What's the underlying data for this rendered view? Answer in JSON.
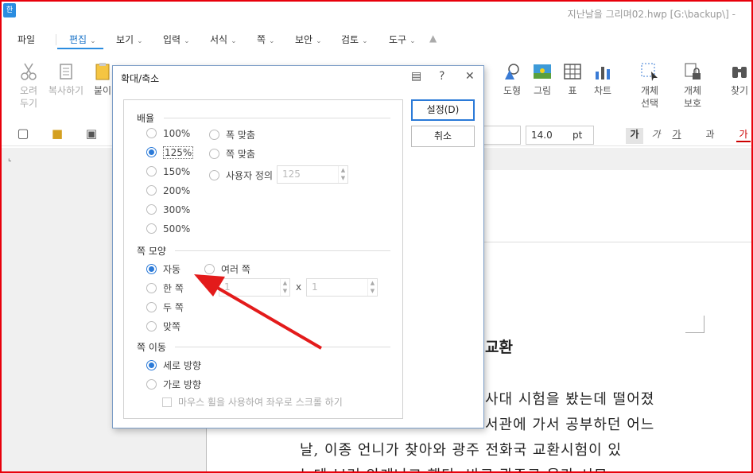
{
  "window": {
    "app_icon": "한",
    "title": "지난날을 그리며02.hwp [G:\\backup\\] - "
  },
  "menu": {
    "items": [
      "파일",
      "편집",
      "보기",
      "입력",
      "서식",
      "쪽",
      "보안",
      "검토",
      "도구"
    ],
    "active": "편집"
  },
  "toolbar": {
    "cut": [
      "오려",
      "두기"
    ],
    "copy": "복사하기",
    "paste": "붙이",
    "shape": "도형",
    "picture": "그림",
    "table": "표",
    "chart": "차트",
    "select_object": [
      "개체",
      "선택"
    ],
    "protect_object": [
      "개체",
      "보호"
    ],
    "find": "찾기"
  },
  "format_bar": {
    "font_size": "14.0",
    "unit": "pt",
    "bold_glyph": "가",
    "italic_glyph": "가",
    "underline_glyph": "가",
    "strike_glyph": "과",
    "color_glyph": "가"
  },
  "dialog": {
    "title": "확대/축소",
    "ok_label": "설정(D)",
    "cancel_label": "취소",
    "zoom": {
      "label": "배율",
      "options": [
        "100%",
        "125%",
        "150%",
        "200%",
        "300%",
        "500%"
      ],
      "selected": "125%",
      "fit_width": "폭 맞춤",
      "fit_page": "쪽 맞춤",
      "custom_label": "사용자 정의",
      "custom_value": "125"
    },
    "page_layout": {
      "label": "쪽 모양",
      "options": [
        "자동",
        "한 쪽",
        "두 쪽",
        "맞쪽"
      ],
      "selected": "자동",
      "multi_label": "여러 쪽",
      "multi_cols": "1",
      "multi_x": "x",
      "multi_rows": "1"
    },
    "page_move": {
      "label": "쪽 이동",
      "vertical": "세로 방향",
      "horizontal": "가로 방향",
      "selected": "세로 방향",
      "wheel_checkbox": "마우스 휠을 사용하여 좌우로 스크롤 하기"
    }
  },
  "document": {
    "heading": "교환",
    "lines": [
      "사대 시험을 봤는데 떨어졌",
      "서관에 가서 공부하던 어느",
      "날, 이종 언니가 찾아와 광주 전화국 교환시험이 있",
      "는데 보러 안게냐고 했다. 바로 광주로 올라 시묘"
    ]
  },
  "colors": {
    "accent": "#2b7ad8",
    "frame_border": "#e8000b",
    "annotation_arrow": "#e31b1b"
  }
}
